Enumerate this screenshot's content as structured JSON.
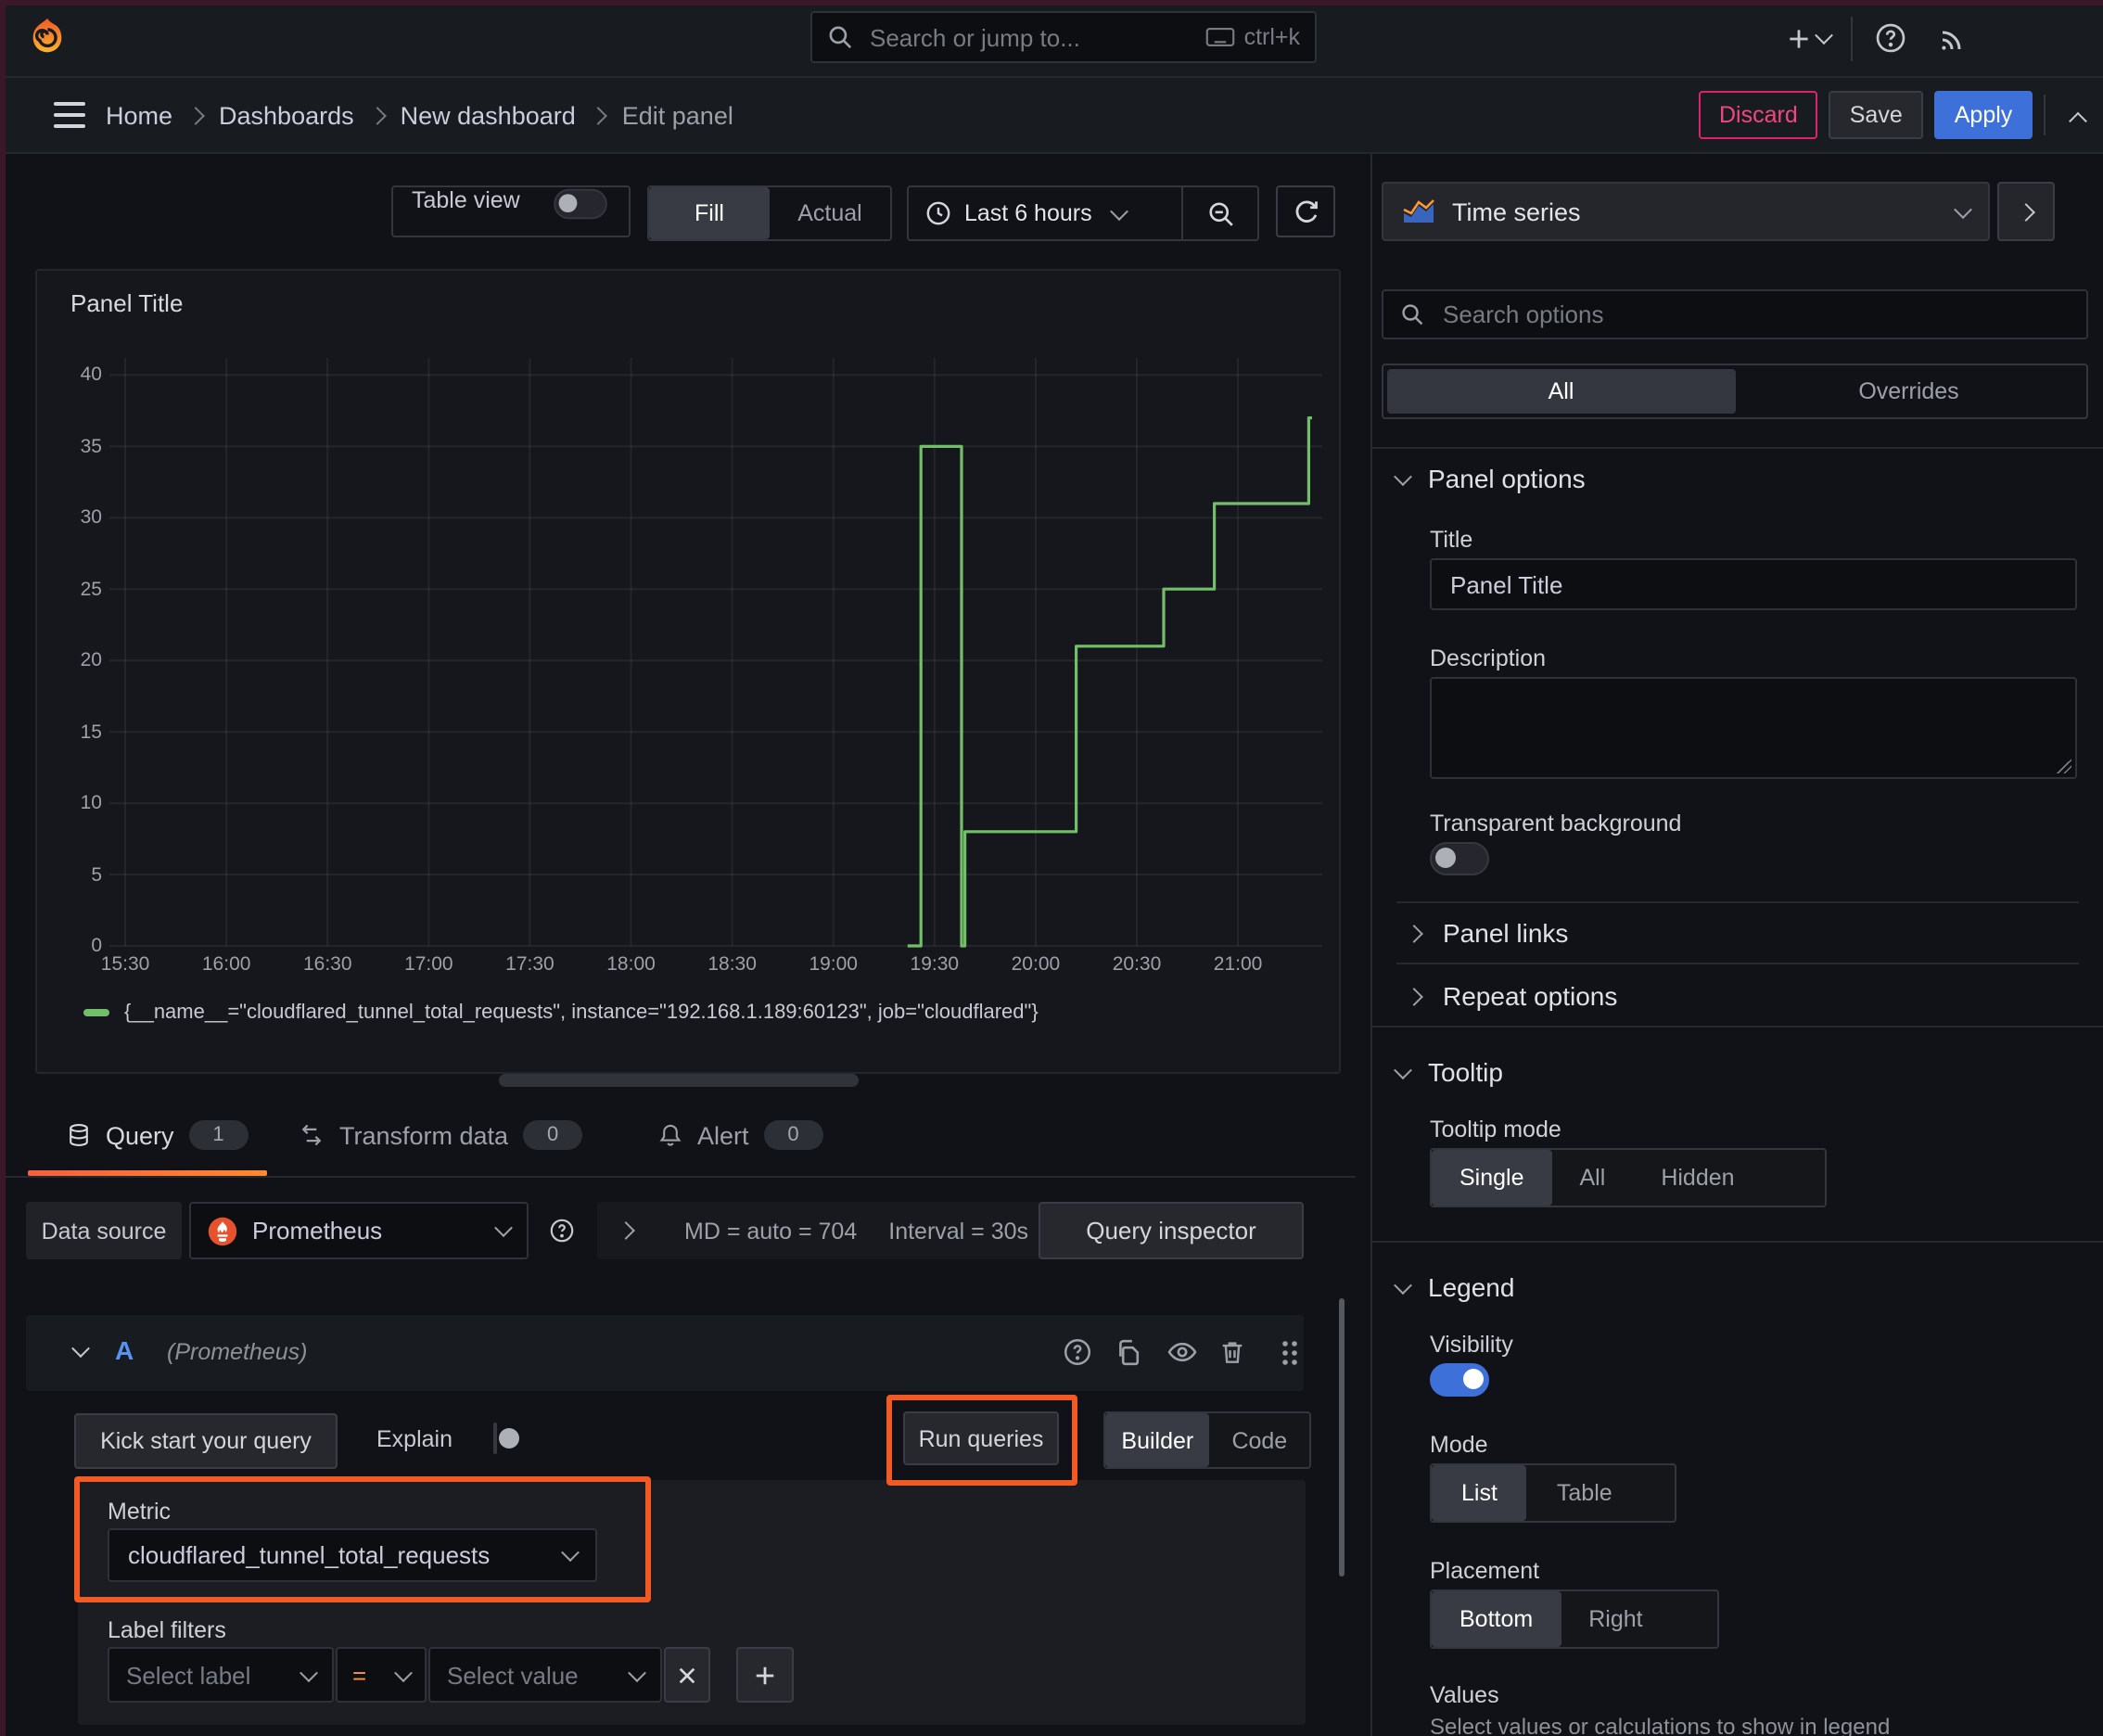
{
  "topnav": {
    "search_placeholder": "Search or jump to...",
    "shortcut": "ctrl+k"
  },
  "breadcrumb": {
    "items": [
      "Home",
      "Dashboards",
      "New dashboard",
      "Edit panel"
    ]
  },
  "header_actions": {
    "discard": "Discard",
    "save": "Save",
    "apply": "Apply"
  },
  "toolbar": {
    "table_view": "Table view",
    "fill": "Fill",
    "actual": "Actual",
    "time_range": "Last 6 hours"
  },
  "panel": {
    "title": "Panel Title",
    "legend": "{__name__=\"cloudflared_tunnel_total_requests\", instance=\"192.168.1.189:60123\", job=\"cloudflared\"}"
  },
  "chart_data": {
    "type": "line",
    "step": true,
    "title": "Panel Title",
    "xlabel": "time",
    "ylabel": "",
    "x_range_minutes": [
      -4.7,
      355
    ],
    "y_range": [
      0,
      41.2
    ],
    "grid": true,
    "legend_position": "bottom",
    "x_ticks": [
      {
        "m": 0,
        "label": "15:30"
      },
      {
        "m": 30,
        "label": "16:00"
      },
      {
        "m": 60,
        "label": "16:30"
      },
      {
        "m": 90,
        "label": "17:00"
      },
      {
        "m": 120,
        "label": "17:30"
      },
      {
        "m": 150,
        "label": "18:00"
      },
      {
        "m": 180,
        "label": "18:30"
      },
      {
        "m": 210,
        "label": "19:00"
      },
      {
        "m": 240,
        "label": "19:30"
      },
      {
        "m": 270,
        "label": "20:00"
      },
      {
        "m": 300,
        "label": "20:30"
      },
      {
        "m": 330,
        "label": "21:00"
      }
    ],
    "y_ticks": [
      0,
      5,
      10,
      15,
      20,
      25,
      30,
      35,
      40
    ],
    "series": [
      {
        "name": "{__name__=\"cloudflared_tunnel_total_requests\", instance=\"192.168.1.189:60123\", job=\"cloudflared\"}",
        "color": "#73bf69",
        "points_minutes_value": [
          [
            232,
            0
          ],
          [
            236,
            0
          ],
          [
            236,
            35
          ],
          [
            248,
            35
          ],
          [
            248,
            0
          ],
          [
            249,
            0
          ],
          [
            249,
            8
          ],
          [
            282,
            8
          ],
          [
            282,
            21
          ],
          [
            308,
            21
          ],
          [
            308,
            25
          ],
          [
            323,
            25
          ],
          [
            323,
            31
          ],
          [
            351,
            31
          ],
          [
            351,
            37
          ],
          [
            352,
            37
          ]
        ]
      }
    ]
  },
  "query_tabs": {
    "query": "Query",
    "query_count": "1",
    "transform": "Transform data",
    "transform_count": "0",
    "alert": "Alert",
    "alert_count": "0"
  },
  "datasource_bar": {
    "label": "Data source",
    "value": "Prometheus",
    "stat_md": "MD = auto = 704",
    "stat_interval": "Interval = 30s",
    "inspector": "Query inspector"
  },
  "query_row": {
    "ref": "A",
    "datasource": "(Prometheus)"
  },
  "query_editor": {
    "kick_start": "Kick start your query",
    "explain": "Explain",
    "run_queries": "Run queries",
    "builder": "Builder",
    "code": "Code",
    "metric_label": "Metric",
    "metric_value": "cloudflared_tunnel_total_requests",
    "label_filters": "Label filters",
    "select_label": "Select label",
    "operator": "=",
    "select_value": "Select value"
  },
  "viz_picker": {
    "value": "Time series"
  },
  "options": {
    "search_placeholder": "Search options",
    "tab_all": "All",
    "tab_overrides": "Overrides",
    "panel_options": {
      "title": "Panel options",
      "title_label": "Title",
      "title_value": "Panel Title",
      "description_label": "Description",
      "transparent_label": "Transparent background"
    },
    "panel_links": "Panel links",
    "repeat_options": "Repeat options",
    "tooltip": {
      "title": "Tooltip",
      "mode_label": "Tooltip mode",
      "modes": [
        "Single",
        "All",
        "Hidden"
      ]
    },
    "legend": {
      "title": "Legend",
      "visibility_label": "Visibility",
      "mode_label": "Mode",
      "modes": [
        "List",
        "Table"
      ],
      "placement_label": "Placement",
      "placements": [
        "Bottom",
        "Right"
      ],
      "values_label": "Values",
      "values_help": "Select values or calculations to show in legend"
    }
  },
  "colors": {
    "accent_blue": "#3d71d9",
    "series_green": "#73bf69",
    "highlight_orange": "#f15a24",
    "discard_pink": "#e0226e",
    "tab_underline_from": "#f55f3e",
    "tab_underline_to": "#ff8833"
  }
}
